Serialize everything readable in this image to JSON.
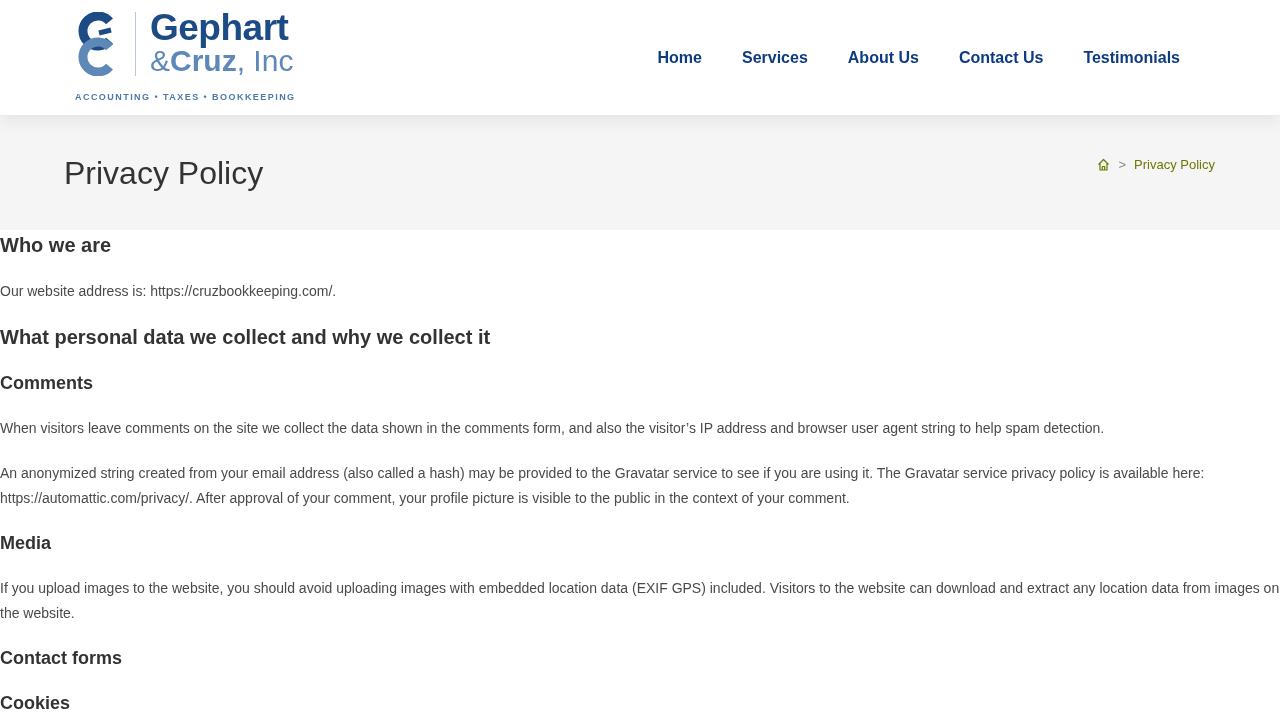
{
  "header": {
    "logo": {
      "name_line_1": "Gephart",
      "name_line_2": "&**Cruz**, Inc",
      "tagline": "ACCOUNTING • TAXES • BOOKKEEPING"
    },
    "nav": [
      "Home",
      "Services",
      "About Us",
      "Contact Us",
      "Testimonials"
    ]
  },
  "page_header": {
    "title": "Privacy Policy",
    "breadcrumb": {
      "separator": ">",
      "current": "Privacy Policy"
    }
  },
  "content": [
    {
      "kind": "heading",
      "text": "Who we are"
    },
    {
      "kind": "paragraph",
      "text": "Our website address is: https://cruzbookkeeping.com/."
    },
    {
      "kind": "heading",
      "text": "What personal data we collect and why we collect it"
    },
    {
      "kind": "subheading",
      "text": "Comments"
    },
    {
      "kind": "paragraph",
      "text": "When visitors leave comments on the site we collect the data shown in the comments form, and also the visitor’s IP address and browser user agent string to help spam detection."
    },
    {
      "kind": "paragraph",
      "text": "An anonymized string created from your email address (also called a hash) may be provided to the Gravatar service to see if you are using it. The Gravatar service privacy policy is available here: https://automattic.com/privacy/. After approval of your comment, your profile picture is visible to the public in the context of your comment."
    },
    {
      "kind": "subheading",
      "text": "Media"
    },
    {
      "kind": "paragraph",
      "text": "If you upload images to the website, you should avoid uploading images with embedded location data (EXIF GPS) included. Visitors to the website can download and extract any location data from images on the website."
    },
    {
      "kind": "subheading",
      "text": "Contact forms"
    },
    {
      "kind": "subheading",
      "text": "Cookies"
    }
  ]
}
